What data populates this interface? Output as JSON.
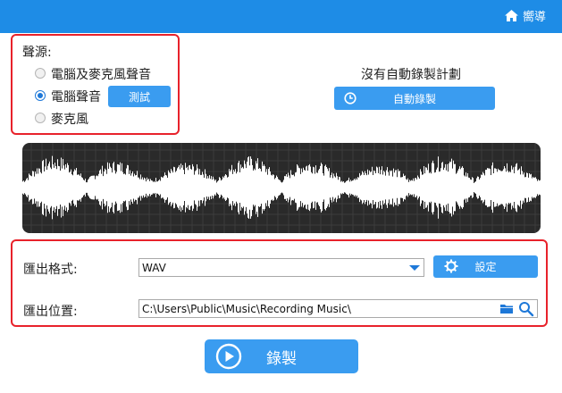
{
  "header": {
    "guide_label": "嚮導",
    "guide_icon": "home-icon"
  },
  "source": {
    "title": "聲源:",
    "options": [
      {
        "label": "電腦及麥克風聲音",
        "selected": false
      },
      {
        "label": "電腦聲音",
        "selected": true
      },
      {
        "label": "麥克風",
        "selected": false
      }
    ],
    "test_button": "測試"
  },
  "schedule": {
    "status_text": "沒有自動錄製計劃",
    "auto_record_button": "自動錄製",
    "icon": "clock-icon"
  },
  "output": {
    "format_label": "匯出格式:",
    "format_value": "WAV",
    "settings_button": "設定",
    "settings_icon": "gear-icon",
    "location_label": "匯出位置:",
    "location_value": "C:\\Users\\Public\\Music\\Recording Music\\",
    "folder_icon": "folder-icon",
    "search_icon": "search-icon"
  },
  "record_button": {
    "label": "錄製",
    "icon": "play-circle-icon"
  },
  "colors": {
    "accent": "#1e8ce6",
    "button": "#3a9cf0",
    "highlight": "#e8222b",
    "wave_bg": "#2a2a2a"
  }
}
